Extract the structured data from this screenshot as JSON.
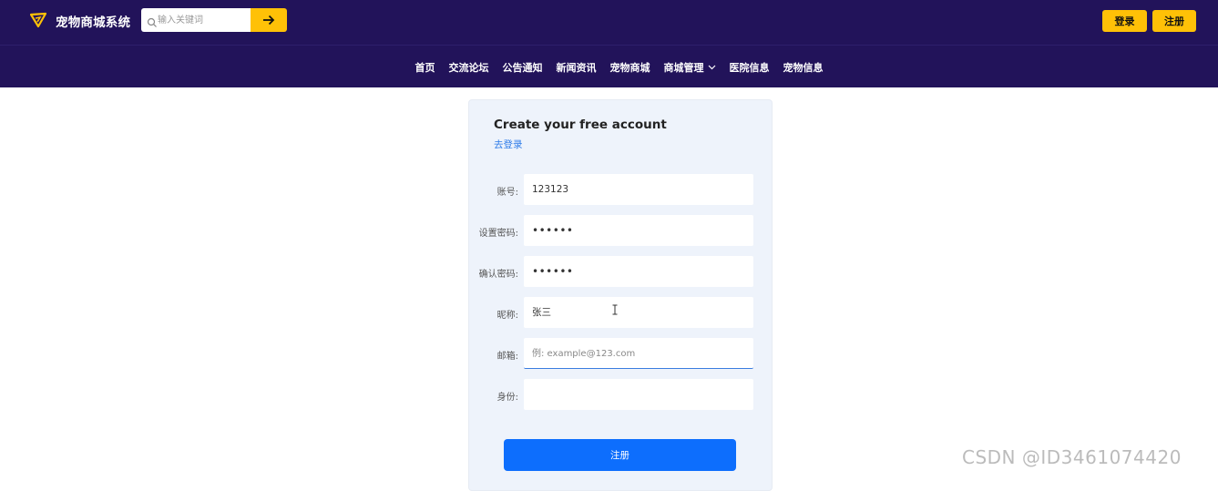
{
  "header": {
    "brand": "宠物商城系统",
    "search": {
      "placeholder": "输入关键词",
      "value": ""
    },
    "login_label": "登录",
    "register_label": "注册",
    "icons": {
      "logo": "paper-plane-icon",
      "search": "search-icon",
      "submit": "arrow-right-icon"
    }
  },
  "nav": {
    "items": [
      {
        "label": "首页"
      },
      {
        "label": "交流论坛"
      },
      {
        "label": "公告通知"
      },
      {
        "label": "新闻资讯"
      },
      {
        "label": "宠物商城"
      },
      {
        "label": "商城管理",
        "has_dropdown": true
      },
      {
        "label": "医院信息"
      },
      {
        "label": "宠物信息"
      }
    ]
  },
  "form": {
    "title": "Create your free account",
    "login_link": "去登录",
    "fields": [
      {
        "label": "账号:",
        "value": "123123"
      },
      {
        "label": "设置密码:",
        "value": "••••••"
      },
      {
        "label": "确认密码:",
        "value": "••••••"
      },
      {
        "label": "昵称:",
        "value": "张三"
      },
      {
        "label": "邮箱:",
        "value": "",
        "placeholder": "例: example@123.com"
      },
      {
        "label": "身份:",
        "value": ""
      }
    ],
    "submit_label": "注册"
  },
  "watermark": "CSDN @ID3461074420",
  "colors": {
    "header_bg": "#22135a",
    "accent": "#ffc107",
    "primary": "#0d6efd",
    "card_bg": "#eef3fb",
    "link": "#2b7ae8"
  }
}
